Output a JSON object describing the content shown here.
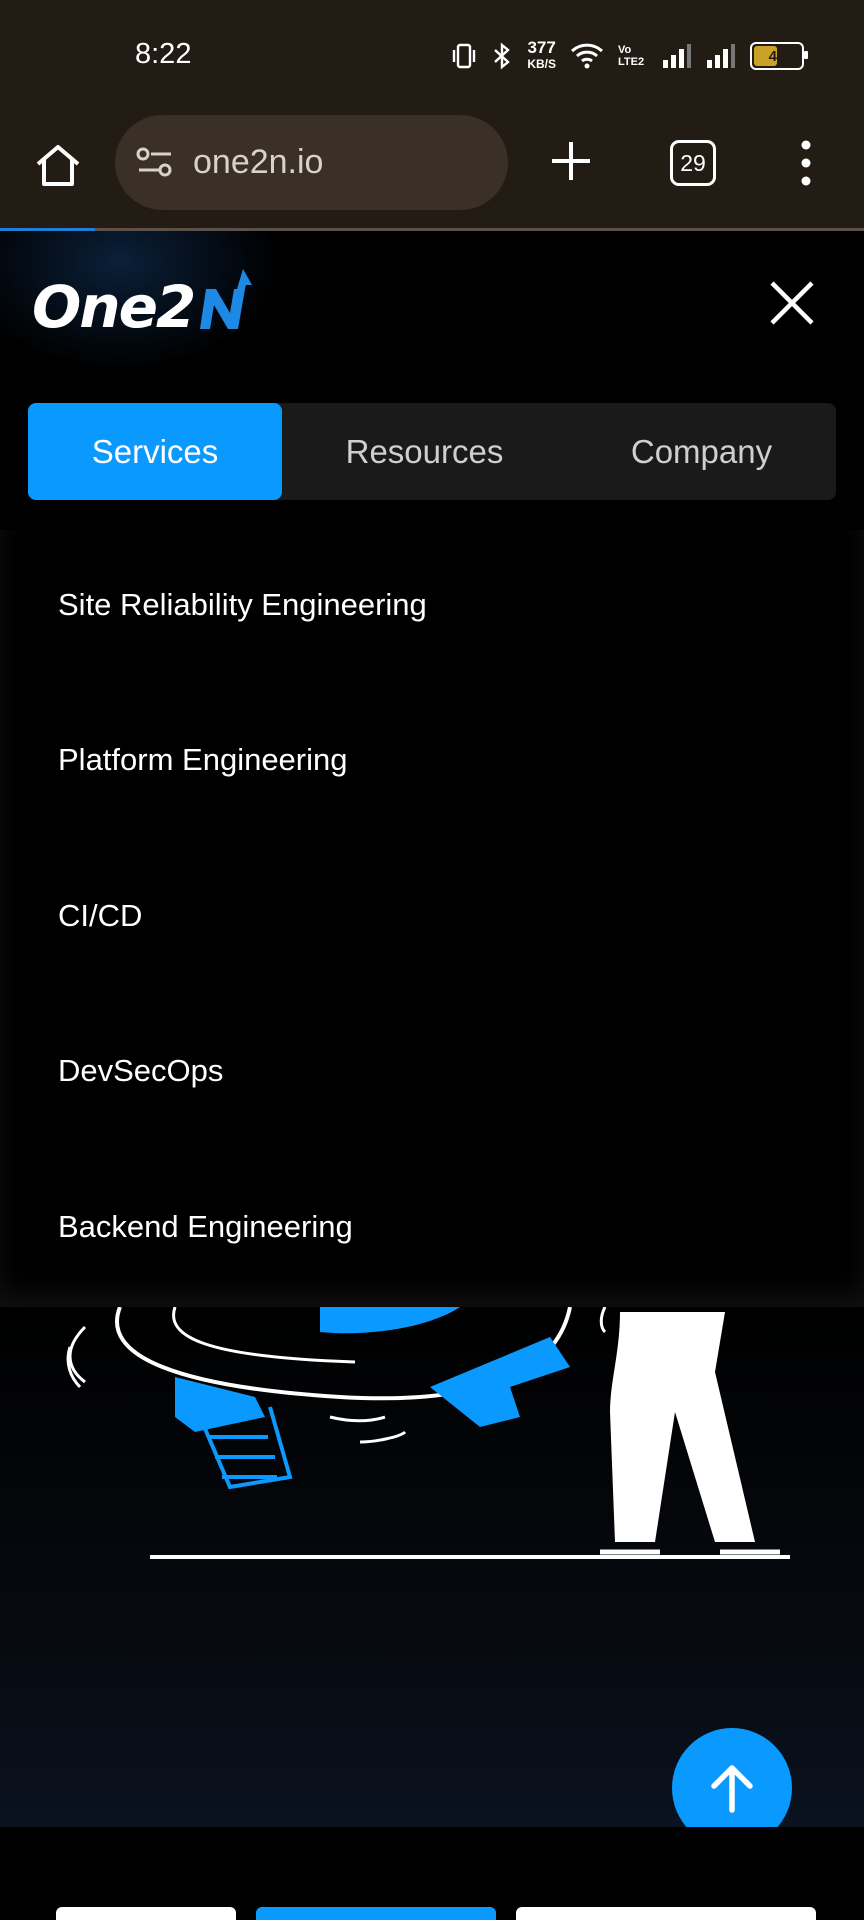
{
  "status_bar": {
    "time": "8:22",
    "data_speed": "377",
    "data_unit": "KB/S",
    "volte": "Vo LTE2",
    "battery": "46"
  },
  "browser": {
    "url": "one2n.io",
    "tab_count": "29",
    "page_load_progress": 0.11
  },
  "header": {
    "logo_text": "One2N",
    "tabs": [
      {
        "label": "Services",
        "active": true
      },
      {
        "label": "Resources",
        "active": false
      },
      {
        "label": "Company",
        "active": false
      }
    ]
  },
  "menu": {
    "items": [
      {
        "label": "Site Reliability Engineering"
      },
      {
        "label": "Platform Engineering"
      },
      {
        "label": "CI/CD"
      },
      {
        "label": "DevSecOps"
      },
      {
        "label": "Backend Engineering"
      }
    ]
  },
  "colors": {
    "accent": "#0a99ff",
    "status_bar_bg": "#231c14",
    "page_bg": "#000000"
  },
  "icons": {
    "home": "home-icon",
    "site_info": "tune-icon",
    "new_tab": "plus-icon",
    "menu": "more-vert-icon",
    "close": "close-icon",
    "scroll_top": "arrow-up-icon"
  }
}
